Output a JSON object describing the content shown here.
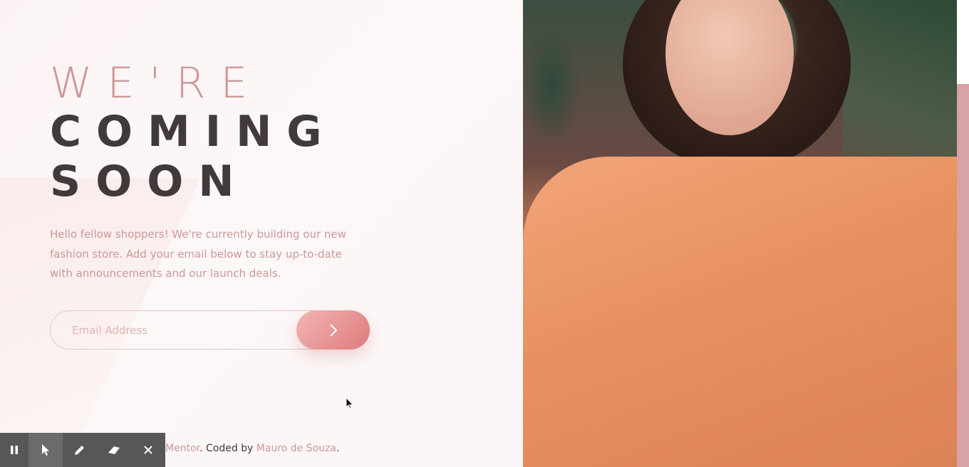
{
  "hero": {
    "title_line1": "WE'RE",
    "title_line2": "COMING",
    "title_line3": "SOON",
    "description": "Hello fellow shoppers! We're currently building our new fashion store. Add your email below to stay up-to-date with announcements and our launch deals."
  },
  "form": {
    "email_placeholder": "Email Address",
    "submit_icon": "chevron-right-icon"
  },
  "footer": {
    "partial_link": "Mentor",
    "middle": ". Coded by ",
    "author": "Mauro de Souza",
    "end": "."
  },
  "toolbar": {
    "items": [
      "pause-icon",
      "pointer-icon",
      "pen-icon",
      "eraser-icon",
      "close-icon"
    ]
  },
  "colors": {
    "accent": "#ce9797",
    "dark": "#423a3a",
    "button_start": "#f2b6b6",
    "button_end": "#e07a7a",
    "stripe": "#d7a3a6"
  }
}
